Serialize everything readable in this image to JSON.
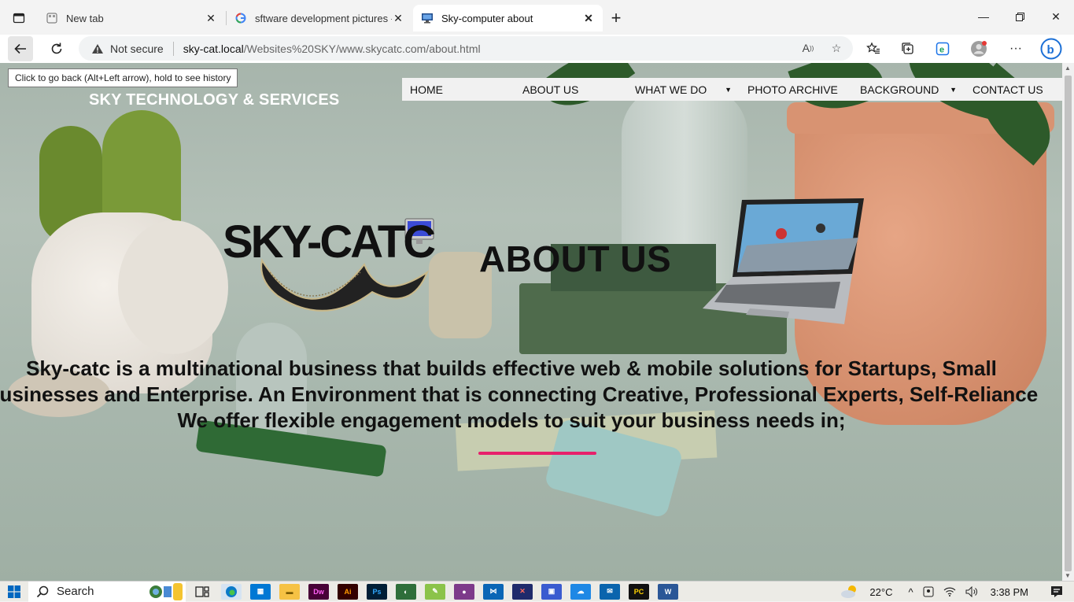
{
  "browser": {
    "tabs": [
      {
        "label": "New tab",
        "favicon": "new-tab-icon"
      },
      {
        "label": "sftware development pictures - Goo",
        "favicon": "google-icon"
      },
      {
        "label": "Sky-computer about",
        "favicon": "monitor-icon"
      }
    ],
    "address": {
      "security_label": "Not secure",
      "host": "sky-cat.local",
      "path": "/Websites%20SKY/www.skycatc.com/about.html"
    },
    "tooltip": "Click to go back (Alt+Left arrow), hold to see history"
  },
  "site": {
    "title": "SKY TECHNOLOGY & SERVICES",
    "logo_text": "SKY-CATC",
    "nav": [
      {
        "label": "HOME",
        "has_dropdown": false
      },
      {
        "label": "ABOUT US",
        "has_dropdown": false
      },
      {
        "label": "WHAT WE DO",
        "has_dropdown": true
      },
      {
        "label": "PHOTO ARCHIVE",
        "has_dropdown": false
      },
      {
        "label": "BACKGROUND",
        "has_dropdown": true
      },
      {
        "label": "CONTACT US",
        "has_dropdown": false
      }
    ],
    "heading": "ABOUT US",
    "lead": "Sky-catc is a multinational business that builds effective web & mobile solutions for Startups, Small\nBusinesses and Enterprise. An Environment that is connecting Creative, Professional Experts, Self-Reliance\nWe offer flexible engagement models to suit your business needs in;",
    "accent_color": "#e7206b"
  },
  "taskbar": {
    "search_label": "Search",
    "temperature": "22°C",
    "time": "3:38 PM"
  }
}
